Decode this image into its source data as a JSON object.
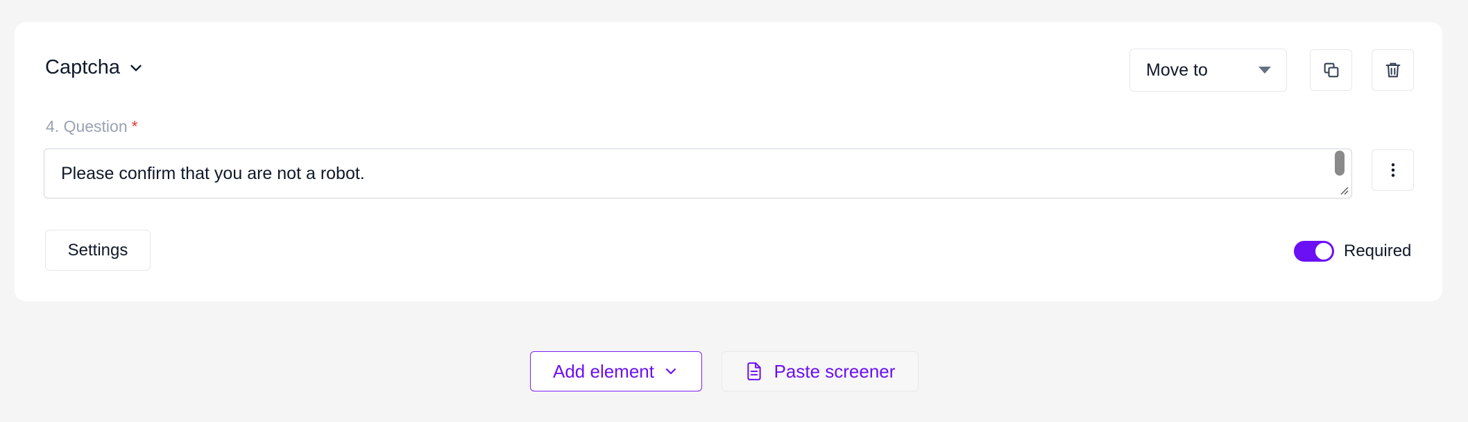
{
  "question": {
    "type_label": "Captcha",
    "number_label": "4. Question",
    "required_mark": "*",
    "text": "Please confirm that you are not a robot."
  },
  "toolbar": {
    "move_to_label": "Move to"
  },
  "footer": {
    "settings_label": "Settings",
    "required_label": "Required",
    "required_on": true
  },
  "actions": {
    "add_element_label": "Add element",
    "paste_screener_label": "Paste screener"
  },
  "colors": {
    "accent": "#6b0ff5",
    "required_star": "#e53935",
    "label_muted": "#98a2b3"
  },
  "icons": [
    "chevron-down-icon",
    "caret-down-icon",
    "copy-icon",
    "trash-icon",
    "kebab-menu-icon",
    "document-icon"
  ]
}
